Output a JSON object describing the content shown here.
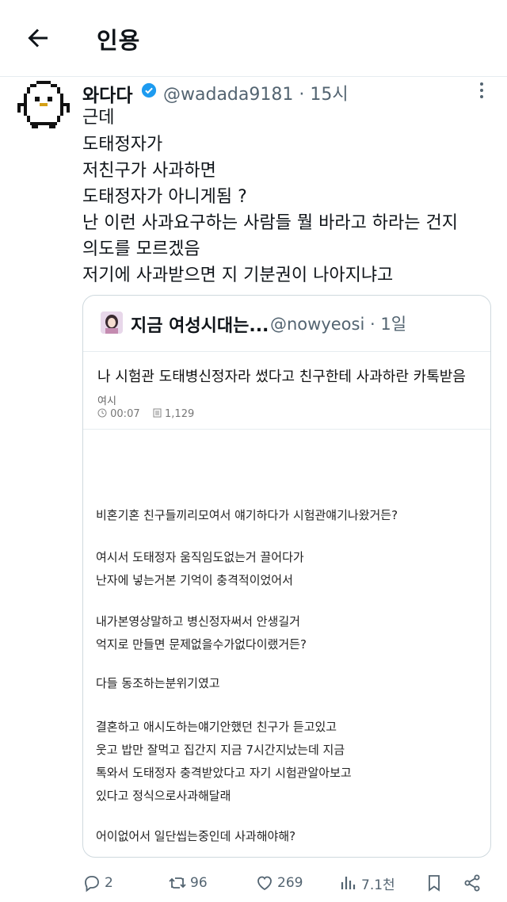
{
  "header": {
    "title": "인용"
  },
  "tweet": {
    "author_name": "와다다",
    "handle_time": "@wadada9181 · 15시",
    "lines": [
      "근데",
      "도태정자가",
      "저친구가 사과하면",
      "도태정자가 아니게됨 ?",
      "난 이런 사과요구하는 사람들 뭘 바라고 하라는 건지",
      "의도를 모르겠음",
      "저기에 사과받으면 지 기분권이 나아지냐고"
    ]
  },
  "quote": {
    "author_name": "지금 여성시대는...",
    "handle_time": "@nowyeosi · 1일",
    "post_title": "나 시험관 도태병신정자라 썼다고 친구한테 사과하란 카톡받음",
    "category": "여시",
    "time": "00:07",
    "views": "1,129",
    "paragraphs": [
      "비혼기혼 친구들끼리모여서 얘기하다가 시험관얘기나왔거든?",
      "여시서 도태정자 움직임도없는거 끌어다가",
      "난자에 넣는거본 기억이 충격적이었어서",
      "내가본영상말하고 병신정자써서 안생길거",
      "억지로 만들면 문제없을수가없다이랬거든?",
      "다들 동조하는분위기였고",
      "결혼하고 애시도하는얘기안했던 친구가 듣고있고",
      "웃고 밥만 잘먹고 집간지 지금 7시간지났는데 지금",
      "톡와서 도태정자 충격받았다고 자기 시험관알아보고",
      "있다고 정식으로사과해달래",
      "어이없어서 일단씹는중인데 사과해야해?"
    ]
  },
  "actions": {
    "replies": "2",
    "retweets": "96",
    "likes": "269",
    "views": "7.1천"
  },
  "colors": {
    "text": "#0f1419",
    "secondary": "#536471",
    "verified": "#1d9bf0",
    "border": "#cfd9de"
  },
  "icons": [
    "back-arrow-icon",
    "verified-badge-icon",
    "more-icon",
    "reply-icon",
    "retweet-icon",
    "like-icon",
    "views-icon",
    "bookmark-icon",
    "share-icon",
    "clock-icon",
    "document-icon"
  ]
}
